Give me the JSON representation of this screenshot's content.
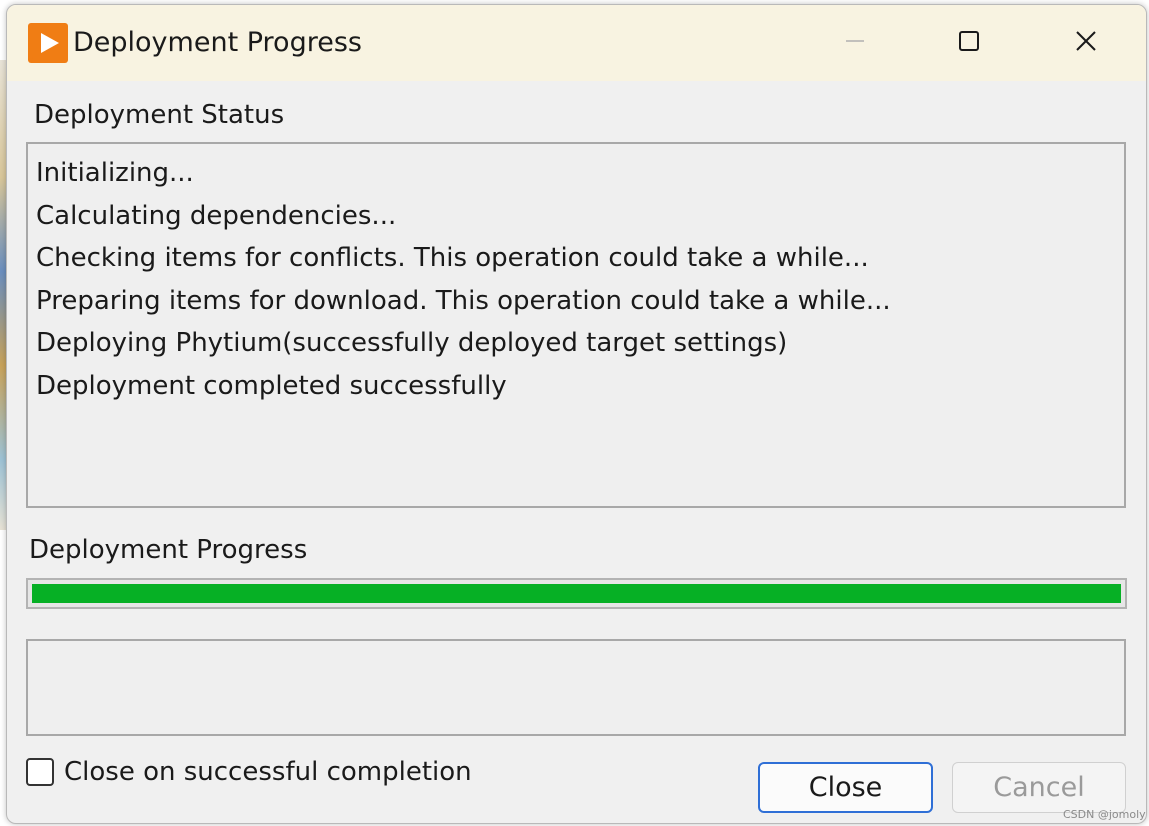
{
  "window": {
    "title": "Deployment Progress",
    "icon": "labview-run-arrow-icon"
  },
  "titlebar_buttons": {
    "minimize_icon": "minimize-icon",
    "maximize_icon": "maximize-icon",
    "close_icon": "close-icon"
  },
  "status": {
    "label": "Deployment Status",
    "lines": [
      "Initializing...",
      "Calculating dependencies...",
      "Checking items for conflicts. This operation could take a while...",
      "Preparing items for download. This operation could take a while...",
      "Deploying Phytium(successfully deployed target settings)",
      "Deployment completed successfully"
    ]
  },
  "progress": {
    "label": "Deployment Progress",
    "value_percent": 100,
    "fill_color": "#06b025"
  },
  "message_box": {
    "text": ""
  },
  "options": {
    "close_on_success_label": "Close on successful completion",
    "close_on_success_checked": false
  },
  "buttons": {
    "close_label": "Close",
    "cancel_label": "Cancel",
    "cancel_enabled": false
  },
  "watermark": "CSDN @jomoly",
  "colors": {
    "titlebar_bg": "#f8f3e1",
    "icon_orange": "#f07d14",
    "focus_border": "#2f6fd6"
  }
}
